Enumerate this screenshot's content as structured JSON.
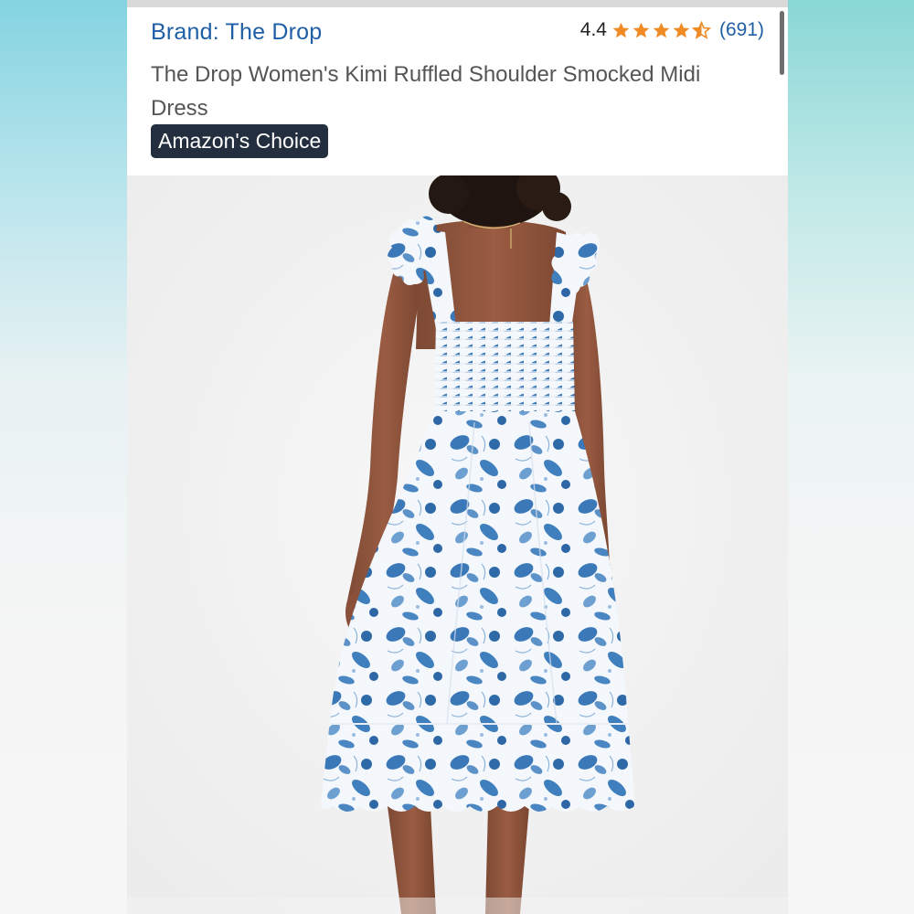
{
  "product": {
    "brand_label": "Brand: The Drop",
    "rating_value": "4.4",
    "rating_stars": 4.4,
    "review_count": "(691)",
    "title": "The Drop Women's Kimi Ruffled Shoulder Smocked Midi Dress",
    "badge": "Amazon's Choice"
  },
  "colors": {
    "brand_link": "#1f5fa6",
    "star": "#f08a24",
    "badge_bg": "#232f3e",
    "dress_blue": "#3a78b7"
  },
  "icons": {
    "star": "star-icon"
  }
}
